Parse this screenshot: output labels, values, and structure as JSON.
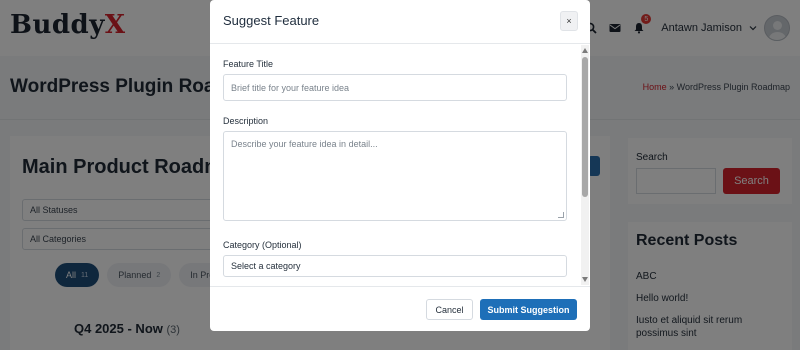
{
  "header": {
    "logo_main": "Buddy",
    "logo_accent": "X",
    "notification_count": "5",
    "username": "Antawn Jamison"
  },
  "title_band": {
    "page_title": "WordPress Plugin Roadmap",
    "breadcrumb_home": "Home",
    "breadcrumb_sep": " » ",
    "breadcrumb_current": "WordPress Plugin Roadmap"
  },
  "main": {
    "roadmap_title": "Main Product Roadmap",
    "status_filter": "All Statuses",
    "category_filter": "All Categories",
    "tabs": [
      {
        "label": "All",
        "count": "11",
        "active": true
      },
      {
        "label": "Planned",
        "count": "2",
        "active": false
      },
      {
        "label": "In Progress",
        "count": "",
        "active": false
      }
    ],
    "quarter_label": "Q4 2025 - Now",
    "quarter_count": "(3)"
  },
  "sidebar": {
    "search_label": "Search",
    "search_button": "Search",
    "recent_posts_title": "Recent Posts",
    "recent_posts": [
      "ABC",
      "Hello world!",
      "Iusto et aliquid sit rerum possimus sint"
    ]
  },
  "modal": {
    "title": "Suggest Feature",
    "close_label": "×",
    "feature_title_label": "Feature Title",
    "feature_title_placeholder": "Brief title for your feature idea",
    "description_label": "Description",
    "description_placeholder": "Describe your feature idea in detail...",
    "category_label": "Category (Optional)",
    "category_selected": "Select a category",
    "cancel_label": "Cancel",
    "submit_label": "Submit Suggestion"
  },
  "colors": {
    "brand_red": "#d7222d",
    "primary_blue": "#1e6fb8",
    "active_pill": "#1f4e7a"
  }
}
